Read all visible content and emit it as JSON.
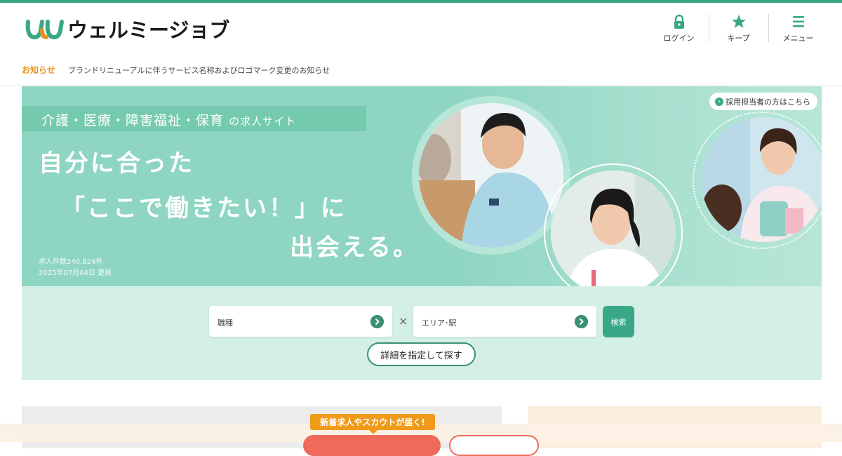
{
  "brand": {
    "name": "ウェルミージョブ",
    "colors": {
      "primary": "#3aa886",
      "accent": "#e8941c",
      "cta": "#ef6a5a"
    }
  },
  "header": {
    "nav": [
      {
        "label": "ログイン",
        "icon": "lock-icon"
      },
      {
        "label": "キープ",
        "icon": "star-icon"
      },
      {
        "label": "メニュー",
        "icon": "hamburger-icon"
      }
    ]
  },
  "notice": {
    "tag": "お知らせ",
    "text": "ブランドリニューアルに伴うサービス名称およびロゴマーク変更のお知らせ"
  },
  "hero": {
    "subtitle_main": "介護・医療・障害福祉・保育",
    "subtitle_suffix": "の求人サイト",
    "line1": "自分に合った",
    "line2": "「ここで働きたい！」に",
    "line3": "出会える。",
    "job_count": "求人件数240,824件",
    "updated": "2025年07月04日 更新",
    "recruiter_link": "採用担当者の方はこちら"
  },
  "search": {
    "job_type_placeholder": "職種",
    "area_placeholder": "エリア･駅",
    "separator": "×",
    "search_button": "検索",
    "detail_button": "詳細を指定して探す"
  },
  "promo": {
    "bubble": "新着求人やスカウトが届く!"
  }
}
